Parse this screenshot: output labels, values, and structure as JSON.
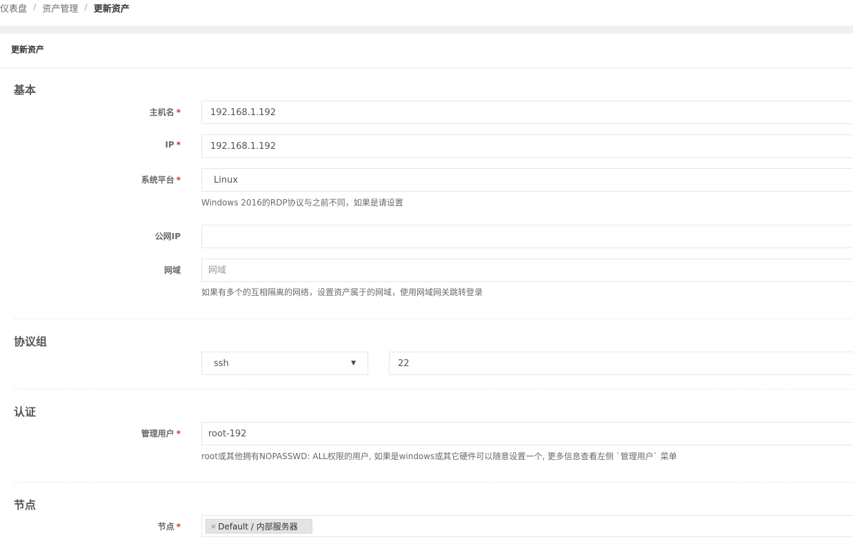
{
  "breadcrumb": {
    "items": [
      "仪表盘",
      "资产管理",
      "更新资产"
    ],
    "separator": "/"
  },
  "panel": {
    "title": "更新资产"
  },
  "sections": {
    "basic": "基本",
    "protocols": "协议组",
    "auth": "认证",
    "nodes": "节点"
  },
  "fields": {
    "hostname": {
      "label": "主机名",
      "value": "192.168.1.192",
      "required": "*"
    },
    "ip": {
      "label": "IP",
      "value": "192.168.1.192",
      "required": "*"
    },
    "platform": {
      "label": "系统平台",
      "value": "Linux",
      "required": "*",
      "help": "Windows 2016的RDP协议与之前不同，如果是请设置"
    },
    "public_ip": {
      "label": "公网IP",
      "value": ""
    },
    "domain": {
      "label": "网域",
      "placeholder": "网域",
      "help": "如果有多个的互相隔离的网络，设置资产属于的网域，使用网域网关跳转登录"
    },
    "protocol": {
      "value": "ssh",
      "port": "22"
    },
    "admin_user": {
      "label": "管理用户",
      "value": "root-192",
      "required": "*",
      "help": "root或其他拥有NOPASSWD: ALL权限的用户, 如果是windows或其它硬件可以随意设置一个, 更多信息查看左侧 `管理用户` 菜单"
    },
    "nodes": {
      "label": "节点",
      "required": "*",
      "tags": [
        "Default / 内部服务器"
      ],
      "remove_glyph": "×"
    }
  },
  "colors": {
    "required": "#c0392b",
    "border": "#e5e6e7"
  },
  "icons": {
    "select_caret": "caret-down-icon"
  }
}
